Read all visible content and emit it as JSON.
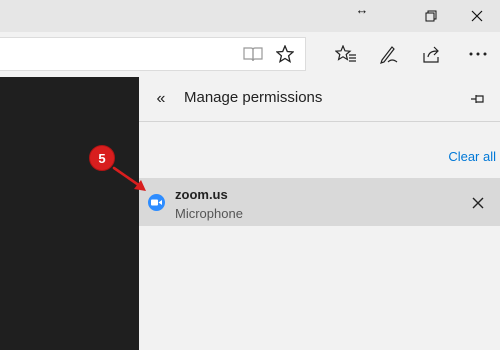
{
  "titlebar": {
    "resize_glyph": "↔",
    "restore_icon": "restore-icon",
    "close_icon": "close-icon"
  },
  "toolbar": {
    "icons": [
      "reading-view-icon",
      "favorite-star-icon",
      "favorites-hub-icon",
      "web-note-icon",
      "share-icon",
      "more-icon"
    ]
  },
  "panel": {
    "title": "Manage permissions",
    "back_glyph": "«",
    "clear_all": "Clear all",
    "permissions": [
      {
        "site": "zoom.us",
        "permission": "Microphone"
      }
    ]
  },
  "annotation": {
    "step": "5",
    "color": "#d81e1e"
  },
  "colors": {
    "accent": "#0078d7",
    "site_icon": "#2d8cff",
    "page_dark": "#1f1f1f"
  }
}
